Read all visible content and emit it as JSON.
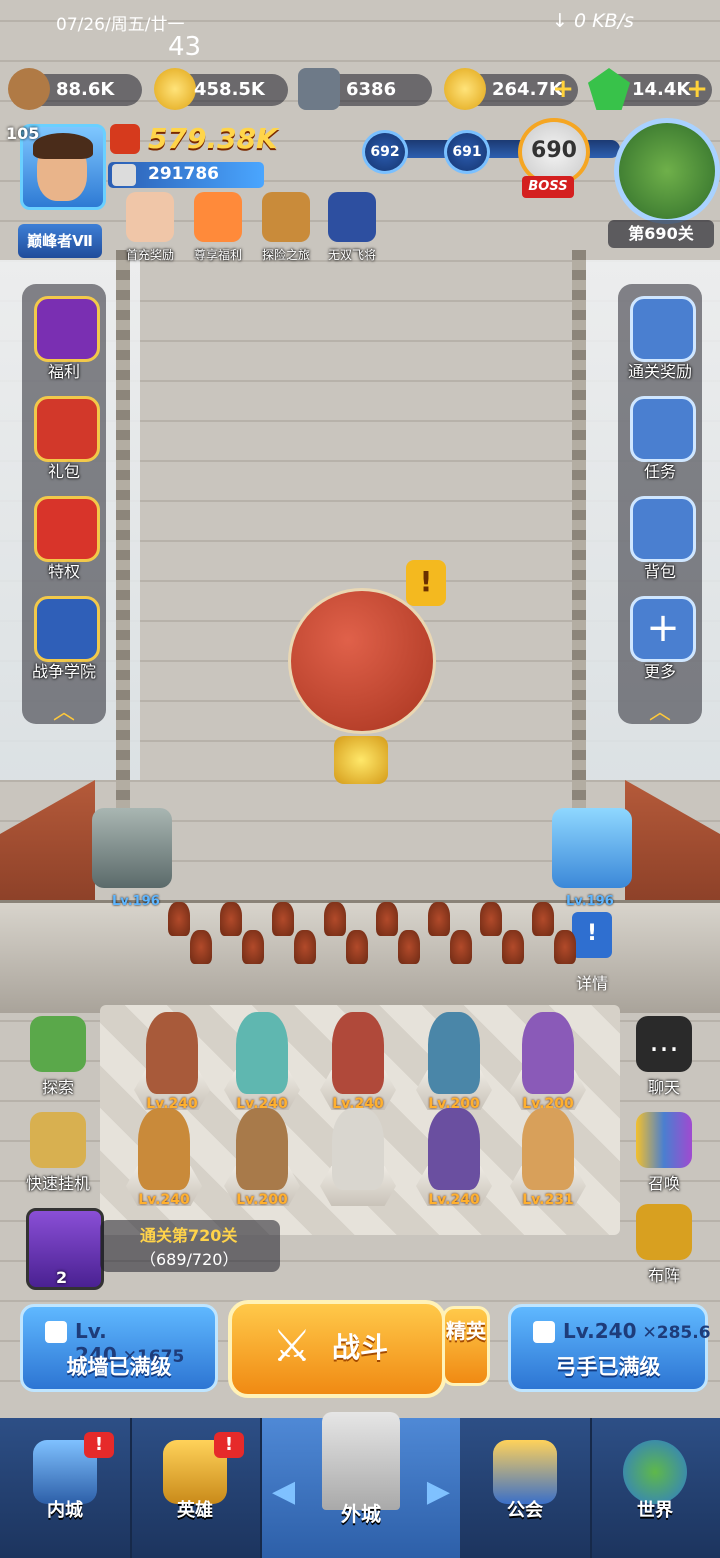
{
  "status_bar": {
    "datetime": "07/26/周五/廿一",
    "indicator": "43",
    "network": "↓ 0 KB/s"
  },
  "resources": [
    {
      "name": "wood-icon",
      "value": "88.6K",
      "color": "#b07a45",
      "plus": false
    },
    {
      "name": "star-coin-icon",
      "value": "458.5K",
      "color": "#f4c430",
      "plus": false
    },
    {
      "name": "iron-ingot-icon",
      "value": "6386",
      "color": "#6e7a88",
      "plus": false
    },
    {
      "name": "gold-coin-icon",
      "value": "264.7K",
      "color": "#f2b51e",
      "plus": true
    },
    {
      "name": "green-gem-icon",
      "value": "14.4K",
      "color": "#38c24a",
      "plus": true
    }
  ],
  "player": {
    "level": "105",
    "rank": "巅峰者Ⅶ",
    "power": "579.38K",
    "score": "291786"
  },
  "events": [
    {
      "label": "首充奖励",
      "color": "#f0c6a8"
    },
    {
      "label": "尊享福利",
      "color": "#ff8a3a"
    },
    {
      "label": "探险之旅",
      "color": "#c98b3a"
    },
    {
      "label": "无双飞将",
      "color": "#2d4fa0"
    }
  ],
  "stage_track": {
    "prev2": "692",
    "prev1": "691",
    "current": "690",
    "boss": "BOSS",
    "stage_label": "第690关"
  },
  "left_menu": [
    {
      "label": "福利",
      "icon": "crown-icon",
      "color": "#7a2fb2"
    },
    {
      "label": "礼包",
      "icon": "gift-icon",
      "color": "#d2382a"
    },
    {
      "label": "特权",
      "icon": "crown-shield-icon",
      "color": "#d8342a"
    },
    {
      "label": "战争学院",
      "icon": "crossed-swords-icon",
      "color": "#2f5fb8"
    }
  ],
  "right_menu": [
    {
      "label": "通关奖励",
      "icon": "gift-box-icon",
      "color": "#4a7fd0"
    },
    {
      "label": "任务",
      "icon": "scroll-icon",
      "color": "#4a7fd0"
    },
    {
      "label": "背包",
      "icon": "backpack-icon",
      "color": "#4a7fd0"
    },
    {
      "label": "更多",
      "icon": "plus-icon",
      "color": "#4a7fd0"
    }
  ],
  "turrets": {
    "left_level": "Lv.196",
    "right_level": "Lv.196",
    "details": "详情"
  },
  "heroes": [
    {
      "level": "Lv.240",
      "color": "#a85a3a"
    },
    {
      "level": "Lv.240",
      "color": "#5fb7b0"
    },
    {
      "level": "Lv.240",
      "color": "#b0493a"
    },
    {
      "level": "Lv.200",
      "color": "#4a86a8"
    },
    {
      "level": "Lv.200",
      "color": "#8a5ab8"
    },
    {
      "level": "Lv.240",
      "color": "#c98a3a"
    },
    {
      "level": "Lv.200",
      "color": "#a87a4a"
    },
    {
      "level": "",
      "color": "#d9d6cf"
    },
    {
      "level": "Lv.240",
      "color": "#6a4fa0"
    },
    {
      "level": "Lv.231",
      "color": "#d8a05a"
    }
  ],
  "lower_left": [
    {
      "label": "探索",
      "icon": "map-icon",
      "color": "#5aa84a"
    },
    {
      "label": "快速挂机",
      "icon": "hourglass-icon",
      "color": "#d8b050"
    }
  ],
  "lower_right": [
    {
      "label": "聊天",
      "icon": "chat-icon",
      "color": "#ffffff"
    },
    {
      "label": "召唤",
      "icon": "cards-icon",
      "color": "#f2c02e"
    },
    {
      "label": "布阵",
      "icon": "chess-rook-icon",
      "color": "#d8a020"
    }
  ],
  "pass_reward": {
    "title": "通关第720关",
    "progress": "（689/720）",
    "chest_count": "2"
  },
  "wall": {
    "level": "Lv. 240",
    "bonus": "1675",
    "label": "城墙已满级"
  },
  "archer": {
    "level": "Lv.240",
    "bonus": "285.6",
    "label": "弓手已满级"
  },
  "battle": {
    "label": "战斗",
    "elite": "精英"
  },
  "nav": [
    {
      "label": "内城",
      "icon": "castle-icon",
      "alert": "!"
    },
    {
      "label": "英雄",
      "icon": "helmet-icon",
      "alert": "!"
    },
    {
      "label": "外城",
      "icon": "tower-icon"
    },
    {
      "label": "公会",
      "icon": "handshake-icon"
    },
    {
      "label": "世界",
      "icon": "globe-icon"
    }
  ],
  "colors": {
    "accent_blue": "#2d75d3",
    "accent_orange": "#f08a13",
    "alert_red": "#e62a2a"
  }
}
